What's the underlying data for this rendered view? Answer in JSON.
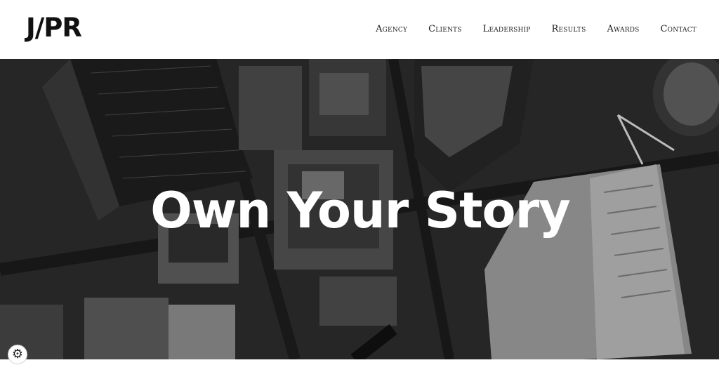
{
  "header": {
    "logo": "J/PR",
    "nav": [
      "Agency",
      "Clients",
      "Leadership",
      "Results",
      "Awards",
      "Contact"
    ]
  },
  "hero": {
    "title": "Own Your Story"
  },
  "widgets": {
    "settings_icon": "gear-icon"
  }
}
